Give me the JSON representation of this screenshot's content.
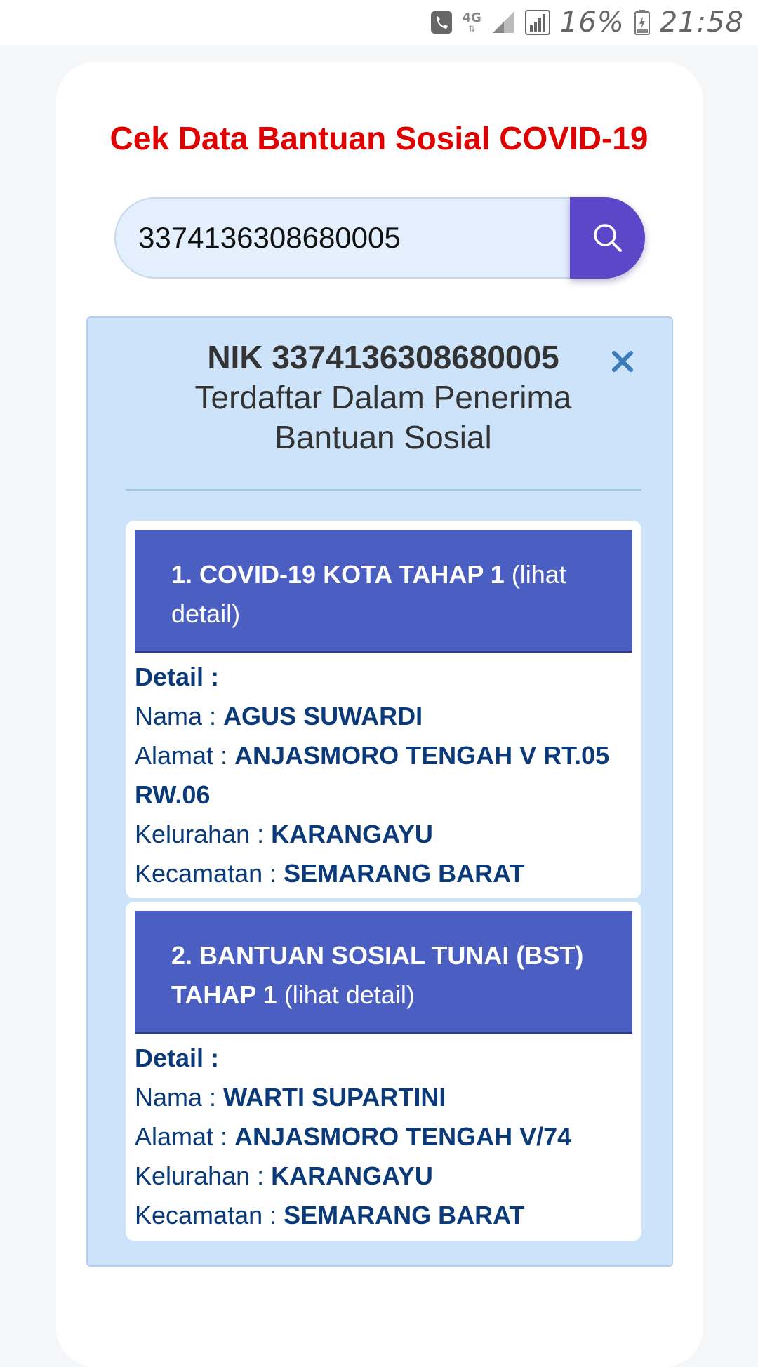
{
  "status_bar": {
    "network": "4G",
    "battery": "16%",
    "time": "21:58",
    "icons": [
      "call-icon",
      "signal-icon",
      "signal-icon",
      "battery-icon"
    ]
  },
  "page": {
    "title": "Cek Data Bantuan Sosial COVID-19"
  },
  "search": {
    "value": "3374136308680005",
    "icon": "search-icon"
  },
  "result": {
    "nik_line": "NIK 3374136308680005",
    "status_line_1": "Terdaftar Dalam Penerima",
    "status_line_2": "Bantuan Sosial",
    "close_icon": "close-icon"
  },
  "programs": [
    {
      "title": "1. COVID-19 KOTA TAHAP 1",
      "link": "(lihat detail)",
      "detail_label": "Detail :",
      "nama_label": "Nama :",
      "nama": "AGUS SUWARDI",
      "alamat_label": "Alamat :",
      "alamat": "ANJASMORO TENGAH V RT.05 RW.06",
      "kelurahan_label": "Kelurahan :",
      "kelurahan": "KARANGAYU",
      "kecamatan_label": "Kecamatan :",
      "kecamatan": "SEMARANG BARAT"
    },
    {
      "title": "2. BANTUAN SOSIAL TUNAI (BST) TAHAP 1",
      "link": "(lihat detail)",
      "detail_label": "Detail :",
      "nama_label": "Nama :",
      "nama": "WARTI SUPARTINI",
      "alamat_label": "Alamat :",
      "alamat": "ANJASMORO TENGAH V/74",
      "kelurahan_label": "Kelurahan :",
      "kelurahan": "KARANGAYU",
      "kecamatan_label": "Kecamatan :",
      "kecamatan": "SEMARANG BARAT"
    }
  ],
  "colors": {
    "title": "#e00000",
    "search_button": "#5b47c8",
    "panel_header": "#4a5fc1",
    "result_bg": "#cce3fa",
    "detail_text": "#0a3a7a"
  }
}
